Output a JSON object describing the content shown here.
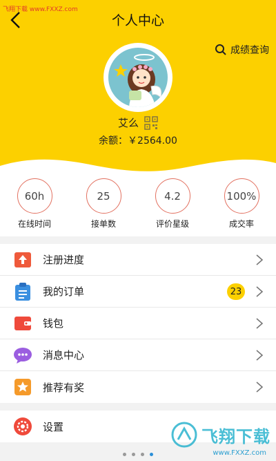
{
  "watermark": "飞翔下载 www.FXXZ.com",
  "header": {
    "title": "个人中心",
    "query_label": "成绩查询"
  },
  "profile": {
    "username": "艾么",
    "balance": "余额：￥2564.00"
  },
  "stats": [
    {
      "value": "60h",
      "label": "在线时间"
    },
    {
      "value": "25",
      "label": "接单数"
    },
    {
      "value": "4.2",
      "label": "评价星级"
    },
    {
      "value": "100%",
      "label": "成交率"
    }
  ],
  "menu": [
    {
      "label": "注册进度",
      "icon": "upload-icon",
      "color": "#ef5a3b"
    },
    {
      "label": "我的订单",
      "icon": "clipboard-icon",
      "color": "#3a8fe0",
      "badge": "23"
    },
    {
      "label": "钱包",
      "icon": "wallet-icon",
      "color": "#ef4a3b"
    },
    {
      "label": "消息中心",
      "icon": "chat-bubble-icon",
      "color": "#9b5ee0"
    },
    {
      "label": "推荐有奖",
      "icon": "star-badge-icon",
      "color": "#f59a2a"
    }
  ],
  "settings": {
    "label": "设置",
    "icon": "gear-icon",
    "color": "#ef4a3b"
  },
  "brand": {
    "name": "飞翔下载",
    "url": "www.FXXZ.com"
  },
  "colors": {
    "accent": "#fcd000",
    "stat_ring": "#e2705f"
  }
}
